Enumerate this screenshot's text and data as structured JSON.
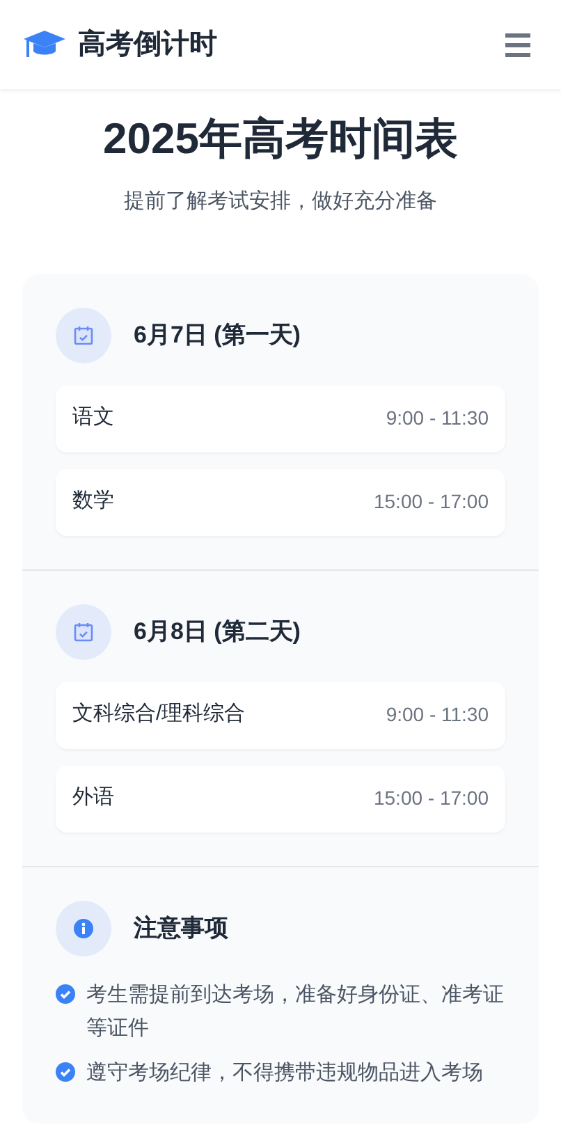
{
  "header": {
    "title": "高考倒计时"
  },
  "page": {
    "title": "2025年高考时间表",
    "subtitle": "提前了解考试安排，做好充分准备"
  },
  "days": [
    {
      "title": "6月7日 (第一天)",
      "exams": [
        {
          "subject": "语文",
          "time": "9:00 - 11:30"
        },
        {
          "subject": "数学",
          "time": "15:00 - 17:00"
        }
      ]
    },
    {
      "title": "6月8日 (第二天)",
      "exams": [
        {
          "subject": "文科综合/理科综合",
          "time": "9:00 - 11:30"
        },
        {
          "subject": "外语",
          "time": "15:00 - 17:00"
        }
      ]
    }
  ],
  "notes": {
    "title": "注意事项",
    "items": [
      "考生需提前到达考场，准备好身份证、准考证等证件",
      "遵守考场纪律，不得携带违规物品进入考场"
    ]
  }
}
